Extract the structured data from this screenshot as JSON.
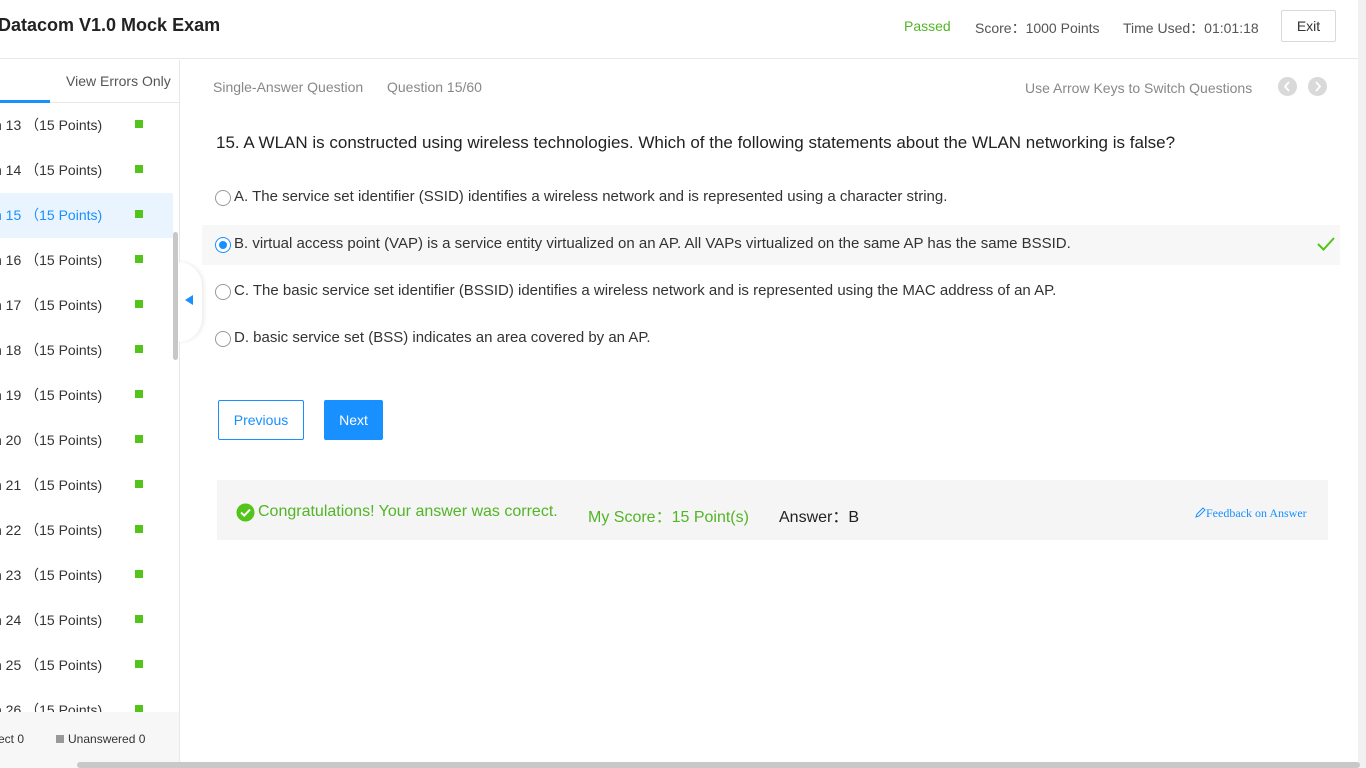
{
  "header": {
    "title": "Datacom V1.0 Mock Exam",
    "status": "Passed",
    "score": "Score：1000 Points",
    "time_used": "Time Used：01:01:18",
    "exit_label": "Exit"
  },
  "sidebar": {
    "view_errors_label": "View Errors Only",
    "items": [
      {
        "label": "n 13 （15 Points)",
        "state": "correct"
      },
      {
        "label": "n 14 （15 Points)",
        "state": "correct"
      },
      {
        "label": "n 15 （15 Points)",
        "state": "correct"
      },
      {
        "label": "n 16 （15 Points)",
        "state": "correct"
      },
      {
        "label": "n 17 （15 Points)",
        "state": "correct"
      },
      {
        "label": "n 18 （15 Points)",
        "state": "correct"
      },
      {
        "label": "n 19 （15 Points)",
        "state": "correct"
      },
      {
        "label": "n 20 （15 Points)",
        "state": "correct"
      },
      {
        "label": "n 21 （15 Points)",
        "state": "correct"
      },
      {
        "label": "n 22 （15 Points)",
        "state": "correct"
      },
      {
        "label": "n 23 （15 Points)",
        "state": "correct"
      },
      {
        "label": "n 24 （15 Points)",
        "state": "correct"
      },
      {
        "label": "n 25 （15 Points)",
        "state": "correct"
      },
      {
        "label": "n 26 （15 Points)",
        "state": "correct"
      }
    ],
    "active_index": 2,
    "footer": {
      "correct": "ect 0",
      "unanswered": "Unanswered 0"
    }
  },
  "main": {
    "question_type": "Single-Answer Question",
    "question_number": "Question 15/60",
    "arrow_hint": "Use Arrow Keys to Switch Questions",
    "question_text": "15. A WLAN is constructed using wireless technologies. Which of the following statements about the WLAN networking is false?",
    "options": [
      {
        "text": "A. The service set identifier (SSID) identifies a wireless network and is represented using a character string."
      },
      {
        "text": "B. virtual access point (VAP) is a service entity virtualized on an AP. All VAPs virtualized on the same AP has the same BSSID."
      },
      {
        "text": "C. The basic service set identifier (BSSID) identifies a wireless network and is represented using the MAC address of an AP."
      },
      {
        "text": "D. basic service set (BSS) indicates an area covered by an AP."
      }
    ],
    "selected_option": "B",
    "previous_label": "Previous",
    "next_label": "Next",
    "result": {
      "message": "Congratulations! Your answer was correct.",
      "my_score": "My Score：15 Point(s)",
      "answer": "Answer：B",
      "feedback_link": "Feedback on Answer"
    }
  },
  "colors": {
    "accent": "#1890ff",
    "success": "#52c41a",
    "success_text": "#52b527"
  },
  "icons": [
    "check-circle-icon",
    "checkmark-icon",
    "chevron-left-icon",
    "chevron-right-icon",
    "collapse-arrow-icon",
    "edit-icon"
  ]
}
